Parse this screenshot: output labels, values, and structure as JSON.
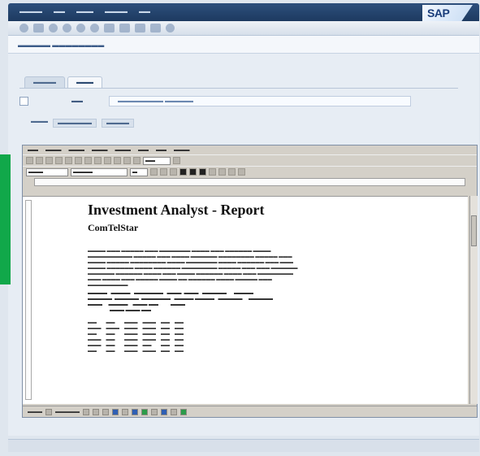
{
  "window": {
    "brand": "SAP"
  },
  "report": {
    "title": "Investment Analyst - Report",
    "subtitle": "ComTelStar"
  }
}
